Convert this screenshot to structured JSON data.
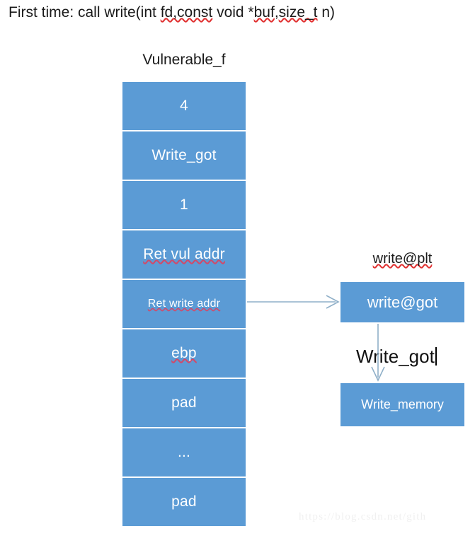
{
  "title": {
    "prefix": "First time: call write(int ",
    "misspelled_1": "fd,const",
    "middle": " void *",
    "misspelled_2": "buf",
    "comma": ",",
    "misspelled_3": "size_t",
    "suffix": " n)",
    "full_text": "First time: call write(int fd,const void *buf,size_t n)"
  },
  "stack": {
    "label": "Vulnerable_f",
    "cells": [
      {
        "text": "4",
        "size": "normal",
        "spellcheck": false
      },
      {
        "text": "Write_got",
        "size": "normal",
        "spellcheck": false
      },
      {
        "text": "1",
        "size": "normal",
        "spellcheck": false
      },
      {
        "text": "Ret vul addr",
        "size": "normal",
        "spellcheck": true
      },
      {
        "text": "Ret write addr",
        "size": "small",
        "spellcheck": true
      },
      {
        "text": "ebp",
        "size": "normal",
        "spellcheck": true
      },
      {
        "text": "pad",
        "size": "normal",
        "spellcheck": false
      },
      {
        "text": "...",
        "size": "normal",
        "spellcheck": false
      },
      {
        "text": "pad",
        "size": "normal",
        "spellcheck": false
      }
    ]
  },
  "right": {
    "plt_label": "write@plt",
    "got_box": "write@got",
    "got_arrow_label": "Write_got",
    "memory_box": "Write_memory"
  },
  "watermark": "https://blog.csdn.net/gith",
  "colors": {
    "box_fill": "#5B9BD5",
    "box_border": "#4A89C0",
    "arrow": "#8FAFC8",
    "text_on_box": "#FFFFFF",
    "text_dark": "#1A1A1A",
    "spellcheck_underline": "#E03030"
  }
}
